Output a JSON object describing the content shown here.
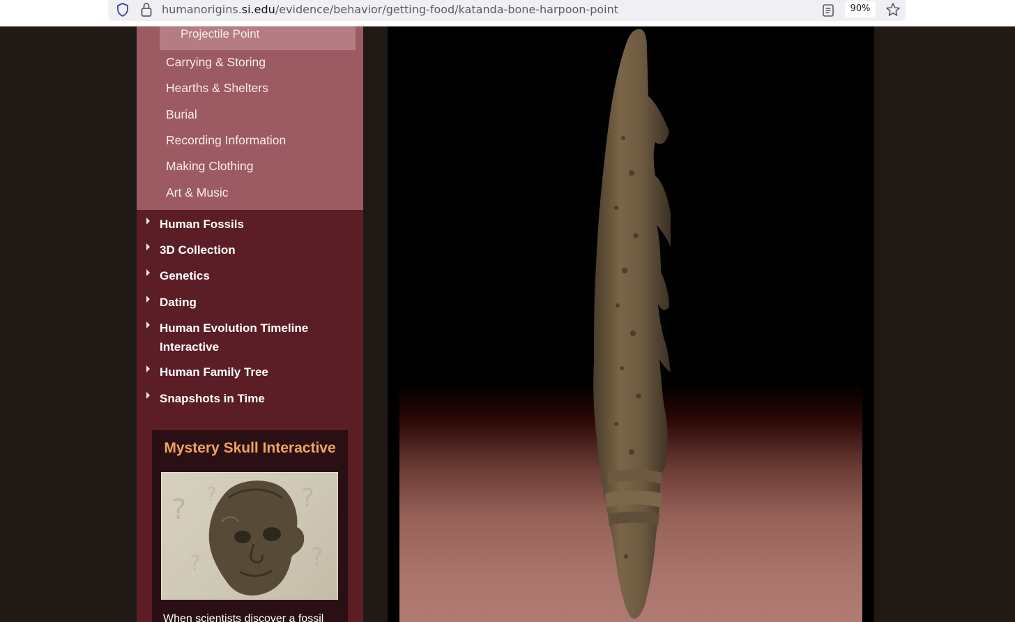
{
  "browser": {
    "url_domain_prefix": "humanorigins.",
    "url_domain": "si.edu",
    "url_path": "/evidence/behavior/getting-food/katanda-bone-harpoon-point",
    "zoom": "90%"
  },
  "sidebar": {
    "subnav_active": "Projectile Point",
    "subnav_items": [
      "Carrying & Storing",
      "Hearths & Shelters",
      "Burial",
      "Recording Information",
      "Making Clothing",
      "Art & Music"
    ],
    "main_items": [
      "Human Fossils",
      "3D Collection",
      "Genetics",
      "Dating",
      "Human Evolution Timeline Interactive",
      "Human Family Tree",
      "Snapshots in Time"
    ]
  },
  "promo": {
    "title": "Mystery Skull Interactive",
    "text": "When scientists discover a fossil"
  },
  "colors": {
    "sidebar_bg": "#5b1e27",
    "subnav_bg": "#9c5a63",
    "promo_title": "#f0a45c"
  }
}
